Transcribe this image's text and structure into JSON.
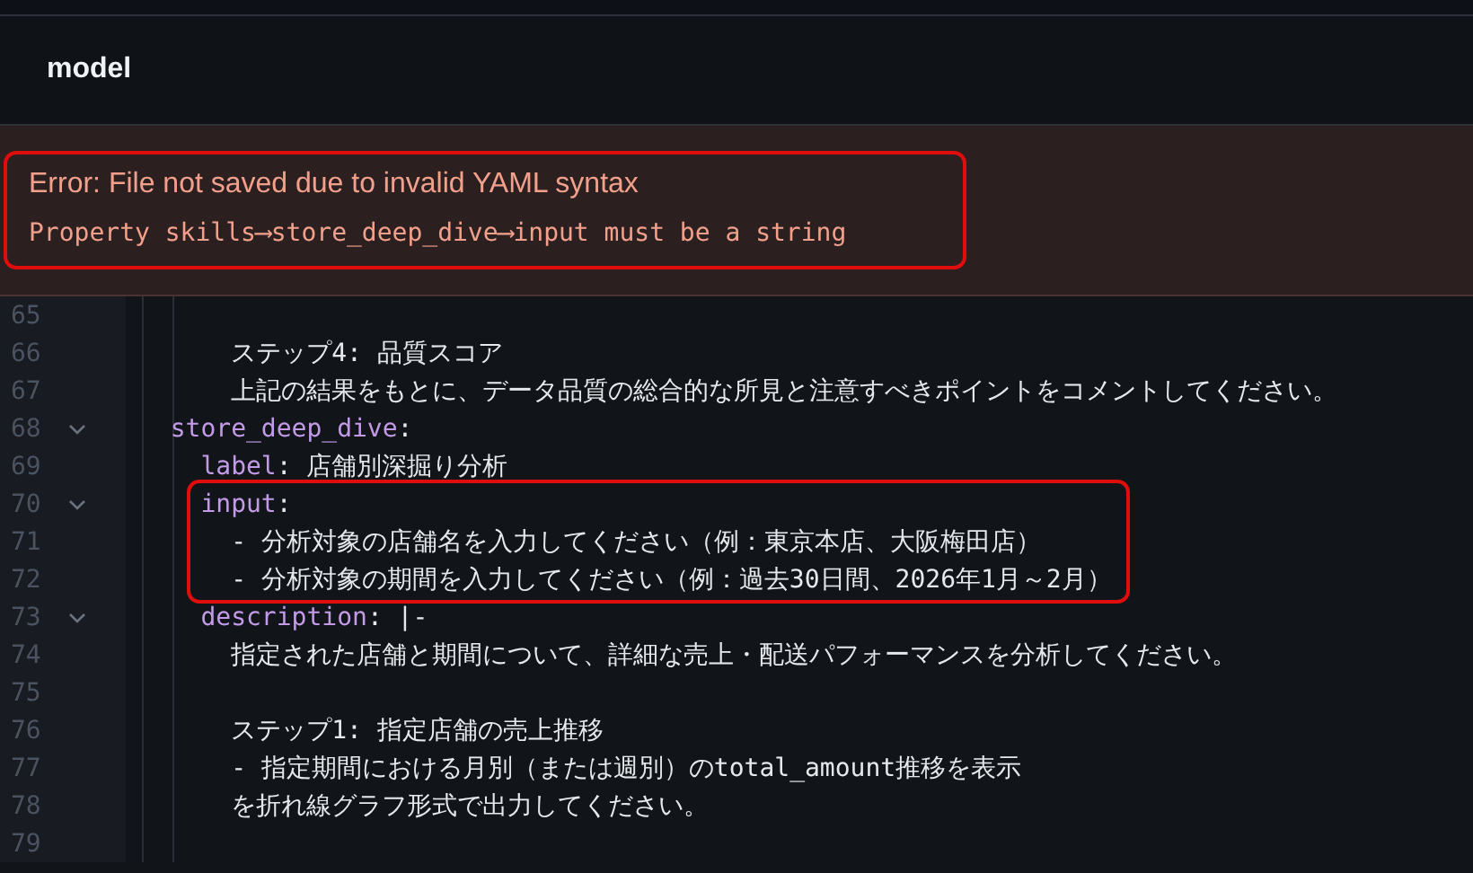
{
  "header": {
    "title": "model"
  },
  "error": {
    "title": "Error: File not saved due to invalid YAML syntax",
    "message": "Property skills⟶store_deep_dive⟶input must be a string",
    "highlighted": true
  },
  "editor": {
    "lines": [
      {
        "number": "65",
        "fold": false,
        "highlighted": false
      },
      {
        "number": "66",
        "fold": false,
        "highlighted": false,
        "parts": [
          {
            "kind": "plain",
            "text": "      ステップ4: 品質スコア"
          }
        ]
      },
      {
        "number": "67",
        "fold": false,
        "highlighted": false,
        "parts": [
          {
            "kind": "plain",
            "text": "      上記の結果をもとに、データ品質の総合的な所見と注意すべきポイントをコメントしてください。"
          }
        ]
      },
      {
        "number": "68",
        "fold": true,
        "highlighted": false,
        "parts": [
          {
            "kind": "key",
            "text": "  store_deep_dive"
          },
          {
            "kind": "plain",
            "text": ":"
          }
        ]
      },
      {
        "number": "69",
        "fold": false,
        "highlighted": false,
        "parts": [
          {
            "kind": "key",
            "text": "    label"
          },
          {
            "kind": "plain",
            "text": ": 店舗別深掘り分析"
          }
        ]
      },
      {
        "number": "70",
        "fold": true,
        "highlighted": true,
        "parts": [
          {
            "kind": "key",
            "text": "    input"
          },
          {
            "kind": "plain",
            "text": ":"
          }
        ]
      },
      {
        "number": "71",
        "fold": false,
        "highlighted": true,
        "parts": [
          {
            "kind": "plain",
            "text": "      - 分析対象の店舗名を入力してください（例：東京本店、大阪梅田店）"
          }
        ]
      },
      {
        "number": "72",
        "fold": false,
        "highlighted": true,
        "parts": [
          {
            "kind": "plain",
            "text": "      - 分析対象の期間を入力してください（例：過去30日間、2026年1月～2月）"
          }
        ]
      },
      {
        "number": "73",
        "fold": true,
        "highlighted": false,
        "parts": [
          {
            "kind": "key",
            "text": "    description"
          },
          {
            "kind": "plain",
            "text": ": |-"
          }
        ]
      },
      {
        "number": "74",
        "fold": false,
        "highlighted": false,
        "parts": [
          {
            "kind": "plain",
            "text": "      指定された店舗と期間について、詳細な売上・配送パフォーマンスを分析してください。"
          }
        ]
      },
      {
        "number": "75",
        "fold": false,
        "highlighted": false
      },
      {
        "number": "76",
        "fold": false,
        "highlighted": false,
        "parts": [
          {
            "kind": "plain",
            "text": "      ステップ1: 指定店舗の売上推移"
          }
        ]
      },
      {
        "number": "77",
        "fold": false,
        "highlighted": false,
        "parts": [
          {
            "kind": "plain",
            "text": "      - 指定期間における月別（または週別）のtotal_amount推移を表示"
          }
        ]
      },
      {
        "number": "78",
        "fold": false,
        "highlighted": false,
        "parts": [
          {
            "kind": "plain",
            "text": "      を折れ線グラフ形式で出力してください。"
          }
        ]
      },
      {
        "number": "79",
        "fold": false,
        "highlighted": false
      }
    ]
  }
}
